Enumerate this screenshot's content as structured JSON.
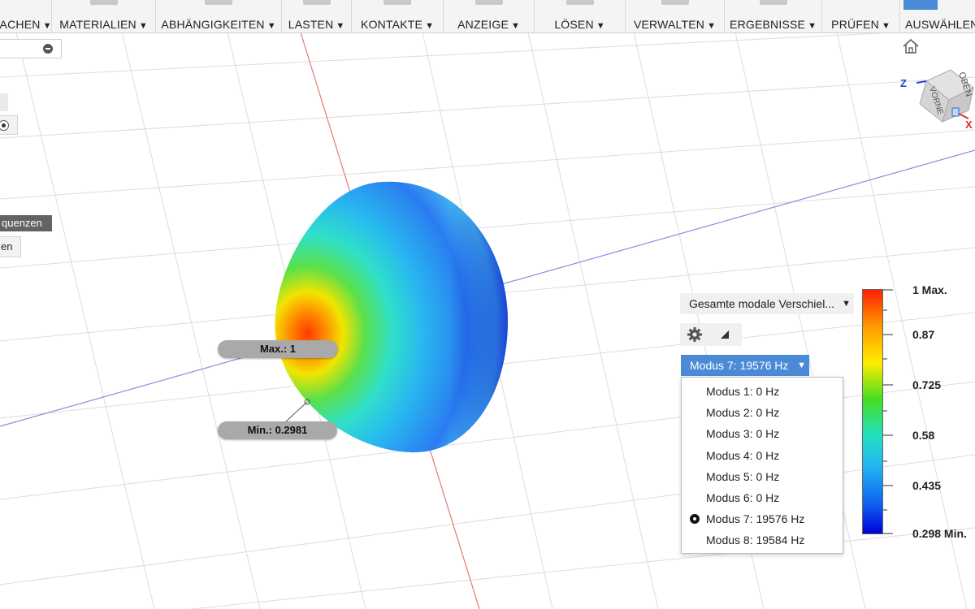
{
  "toolbar": {
    "groups": [
      {
        "label": "ACHEN"
      },
      {
        "label": "MATERIALIEN"
      },
      {
        "label": "ABHÄNGIGKEITEN"
      },
      {
        "label": "LASTEN"
      },
      {
        "label": "KONTAKTE"
      },
      {
        "label": "ANZEIGE"
      },
      {
        "label": "LÖSEN"
      },
      {
        "label": "VERWALTEN"
      },
      {
        "label": "ERGEBNISSE"
      },
      {
        "label": "PRÜFEN"
      },
      {
        "label": "AUSWÄHLEN"
      }
    ]
  },
  "browser": {
    "dark_item": "quenzen",
    "light_item": "en"
  },
  "viewcube": {
    "axis_z": "Z",
    "axis_x": "X",
    "face_top": "OBEN",
    "face_front": "VORNE"
  },
  "probes": {
    "max_label": "Max.: 1",
    "min_label": "Min.: 0.2981"
  },
  "results": {
    "result_type": "Gesamte modale Verschiel...",
    "selected_mode": "Modus 7: 19576 Hz",
    "modes": [
      {
        "label": "Modus 1: 0 Hz",
        "selected": false
      },
      {
        "label": "Modus 2: 0 Hz",
        "selected": false
      },
      {
        "label": "Modus 3: 0 Hz",
        "selected": false
      },
      {
        "label": "Modus 4: 0 Hz",
        "selected": false
      },
      {
        "label": "Modus 5: 0 Hz",
        "selected": false
      },
      {
        "label": "Modus 6: 0 Hz",
        "selected": false
      },
      {
        "label": "Modus 7: 19576 Hz",
        "selected": true
      },
      {
        "label": "Modus 8: 19584 Hz",
        "selected": false
      }
    ]
  },
  "legend": {
    "labels": [
      "1 Max.",
      "0.87",
      "0.725",
      "0.58",
      "0.435",
      "0.298 Min."
    ],
    "max": 1,
    "min": 0.298
  },
  "colors": {
    "accent": "#4a8ad6",
    "axis_red": "#e06060",
    "axis_blue": "#6b6be0"
  }
}
